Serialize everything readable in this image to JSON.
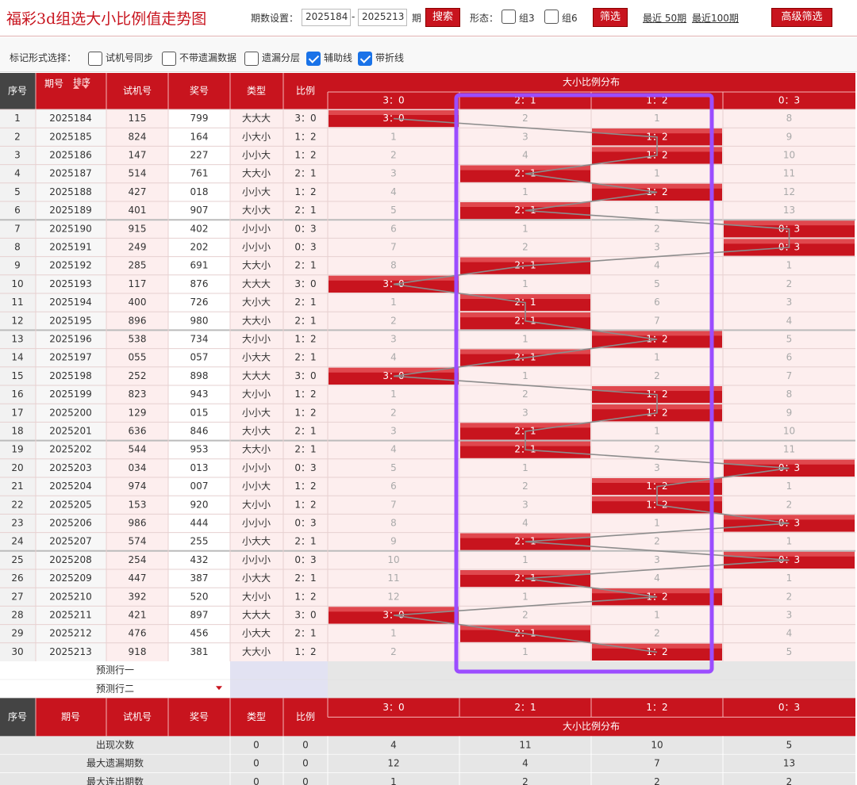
{
  "title": "福彩3d组选大小比例值走势图",
  "period_setting": {
    "label": "期数设置：",
    "from": "2025184",
    "dash": "-",
    "to": "2025213",
    "unit": "期",
    "search_button": "搜索"
  },
  "form": {
    "label": "形态：",
    "options": [
      {
        "label": "组3",
        "checked": false
      },
      {
        "label": "组6",
        "checked": false
      }
    ],
    "filter_button": "筛选"
  },
  "recent_links": [
    "最近 50期",
    "最近100期"
  ],
  "advanced_button": "高级筛选",
  "mark_options": {
    "label": "标记形式选择：",
    "items": [
      {
        "label": "试机号同步",
        "checked": false
      },
      {
        "label": "不带遗漏数据",
        "checked": false
      },
      {
        "label": "遗漏分层",
        "checked": false
      },
      {
        "label": "辅助线",
        "checked": true
      },
      {
        "label": "带折线",
        "checked": true
      }
    ]
  },
  "table": {
    "headers": {
      "seq": "序号",
      "period": "期号",
      "sort_label": "排序",
      "trial": "试机号",
      "prize": "奖号",
      "type": "类型",
      "ratio": "比例",
      "dist": "大小比例分布"
    },
    "dist_columns": [
      "3：0",
      "2：1",
      "1：2",
      "0：3"
    ],
    "rows": [
      {
        "seq": "1",
        "period": "2025184",
        "trial": "115",
        "prize": "799",
        "type": "大大大",
        "ratio": "3：0",
        "dist": [
          "3：0",
          "2",
          "1",
          "8"
        ],
        "hit": 0
      },
      {
        "seq": "2",
        "period": "2025185",
        "trial": "824",
        "prize": "164",
        "type": "小大小",
        "ratio": "1：2",
        "dist": [
          "1",
          "3",
          "1：2",
          "9"
        ],
        "hit": 2
      },
      {
        "seq": "3",
        "period": "2025186",
        "trial": "147",
        "prize": "227",
        "type": "小小大",
        "ratio": "1：2",
        "dist": [
          "2",
          "4",
          "1：2",
          "10"
        ],
        "hit": 2
      },
      {
        "seq": "4",
        "period": "2025187",
        "trial": "514",
        "prize": "761",
        "type": "大大小",
        "ratio": "2：1",
        "dist": [
          "3",
          "2：1",
          "1",
          "11"
        ],
        "hit": 1
      },
      {
        "seq": "5",
        "period": "2025188",
        "trial": "427",
        "prize": "018",
        "type": "小小大",
        "ratio": "1：2",
        "dist": [
          "4",
          "1",
          "1：2",
          "12"
        ],
        "hit": 2
      },
      {
        "seq": "6",
        "period": "2025189",
        "trial": "401",
        "prize": "907",
        "type": "大小大",
        "ratio": "2：1",
        "dist": [
          "5",
          "2：1",
          "1",
          "13"
        ],
        "hit": 1
      },
      {
        "seq": "7",
        "period": "2025190",
        "trial": "915",
        "prize": "402",
        "type": "小小小",
        "ratio": "0：3",
        "dist": [
          "6",
          "1",
          "2",
          "0：3"
        ],
        "hit": 3
      },
      {
        "seq": "8",
        "period": "2025191",
        "trial": "249",
        "prize": "202",
        "type": "小小小",
        "ratio": "0：3",
        "dist": [
          "7",
          "2",
          "3",
          "0：3"
        ],
        "hit": 3
      },
      {
        "seq": "9",
        "period": "2025192",
        "trial": "285",
        "prize": "691",
        "type": "大大小",
        "ratio": "2：1",
        "dist": [
          "8",
          "2：1",
          "4",
          "1"
        ],
        "hit": 1
      },
      {
        "seq": "10",
        "period": "2025193",
        "trial": "117",
        "prize": "876",
        "type": "大大大",
        "ratio": "3：0",
        "dist": [
          "3：0",
          "1",
          "5",
          "2"
        ],
        "hit": 0
      },
      {
        "seq": "11",
        "period": "2025194",
        "trial": "400",
        "prize": "726",
        "type": "大小大",
        "ratio": "2：1",
        "dist": [
          "1",
          "2：1",
          "6",
          "3"
        ],
        "hit": 1
      },
      {
        "seq": "12",
        "period": "2025195",
        "trial": "896",
        "prize": "980",
        "type": "大大小",
        "ratio": "2：1",
        "dist": [
          "2",
          "2：1",
          "7",
          "4"
        ],
        "hit": 1
      },
      {
        "seq": "13",
        "period": "2025196",
        "trial": "538",
        "prize": "734",
        "type": "大小小",
        "ratio": "1：2",
        "dist": [
          "3",
          "1",
          "1：2",
          "5"
        ],
        "hit": 2
      },
      {
        "seq": "14",
        "period": "2025197",
        "trial": "055",
        "prize": "057",
        "type": "小大大",
        "ratio": "2：1",
        "dist": [
          "4",
          "2：1",
          "1",
          "6"
        ],
        "hit": 1
      },
      {
        "seq": "15",
        "period": "2025198",
        "trial": "252",
        "prize": "898",
        "type": "大大大",
        "ratio": "3：0",
        "dist": [
          "3：0",
          "1",
          "2",
          "7"
        ],
        "hit": 0
      },
      {
        "seq": "16",
        "period": "2025199",
        "trial": "823",
        "prize": "943",
        "type": "大小小",
        "ratio": "1：2",
        "dist": [
          "1",
          "2",
          "1：2",
          "8"
        ],
        "hit": 2
      },
      {
        "seq": "17",
        "period": "2025200",
        "trial": "129",
        "prize": "015",
        "type": "小小大",
        "ratio": "1：2",
        "dist": [
          "2",
          "3",
          "1：2",
          "9"
        ],
        "hit": 2
      },
      {
        "seq": "18",
        "period": "2025201",
        "trial": "636",
        "prize": "846",
        "type": "大小大",
        "ratio": "2：1",
        "dist": [
          "3",
          "2：1",
          "1",
          "10"
        ],
        "hit": 1
      },
      {
        "seq": "19",
        "period": "2025202",
        "trial": "544",
        "prize": "953",
        "type": "大大小",
        "ratio": "2：1",
        "dist": [
          "4",
          "2：1",
          "2",
          "11"
        ],
        "hit": 1
      },
      {
        "seq": "20",
        "period": "2025203",
        "trial": "034",
        "prize": "013",
        "type": "小小小",
        "ratio": "0：3",
        "dist": [
          "5",
          "1",
          "3",
          "0：3"
        ],
        "hit": 3
      },
      {
        "seq": "21",
        "period": "2025204",
        "trial": "974",
        "prize": "007",
        "type": "小小大",
        "ratio": "1：2",
        "dist": [
          "6",
          "2",
          "1：2",
          "1"
        ],
        "hit": 2
      },
      {
        "seq": "22",
        "period": "2025205",
        "trial": "153",
        "prize": "920",
        "type": "大小小",
        "ratio": "1：2",
        "dist": [
          "7",
          "3",
          "1：2",
          "2"
        ],
        "hit": 2
      },
      {
        "seq": "23",
        "period": "2025206",
        "trial": "986",
        "prize": "444",
        "type": "小小小",
        "ratio": "0：3",
        "dist": [
          "8",
          "4",
          "1",
          "0：3"
        ],
        "hit": 3
      },
      {
        "seq": "24",
        "period": "2025207",
        "trial": "574",
        "prize": "255",
        "type": "小大大",
        "ratio": "2：1",
        "dist": [
          "9",
          "2：1",
          "2",
          "1"
        ],
        "hit": 1
      },
      {
        "seq": "25",
        "period": "2025208",
        "trial": "254",
        "prize": "432",
        "type": "小小小",
        "ratio": "0：3",
        "dist": [
          "10",
          "1",
          "3",
          "0：3"
        ],
        "hit": 3
      },
      {
        "seq": "26",
        "period": "2025209",
        "trial": "447",
        "prize": "387",
        "type": "小大大",
        "ratio": "2：1",
        "dist": [
          "11",
          "2：1",
          "4",
          "1"
        ],
        "hit": 1
      },
      {
        "seq": "27",
        "period": "2025210",
        "trial": "392",
        "prize": "520",
        "type": "大小小",
        "ratio": "1：2",
        "dist": [
          "12",
          "1",
          "1：2",
          "2"
        ],
        "hit": 2
      },
      {
        "seq": "28",
        "period": "2025211",
        "trial": "421",
        "prize": "897",
        "type": "大大大",
        "ratio": "3：0",
        "dist": [
          "3：0",
          "2",
          "1",
          "3"
        ],
        "hit": 0
      },
      {
        "seq": "29",
        "period": "2025212",
        "trial": "476",
        "prize": "456",
        "type": "小大大",
        "ratio": "2：1",
        "dist": [
          "1",
          "2：1",
          "2",
          "4"
        ],
        "hit": 1
      },
      {
        "seq": "30",
        "period": "2025213",
        "trial": "918",
        "prize": "381",
        "type": "大大小",
        "ratio": "1：2",
        "dist": [
          "2",
          "1",
          "1：2",
          "5"
        ],
        "hit": 2
      }
    ],
    "predict_rows": [
      "预测行一",
      "预测行二"
    ],
    "stats": [
      {
        "label": "出现次数",
        "type": "0",
        "ratio": "0",
        "dist": [
          "4",
          "11",
          "10",
          "5"
        ]
      },
      {
        "label": "最大遗漏期数",
        "type": "0",
        "ratio": "0",
        "dist": [
          "12",
          "4",
          "7",
          "13"
        ]
      },
      {
        "label": "最大连出期数",
        "type": "0",
        "ratio": "0",
        "dist": [
          "1",
          "2",
          "2",
          "2"
        ]
      }
    ]
  },
  "colors": {
    "brand_red": "#c8141e",
    "header_red": "#c8141e",
    "cell_pink": "#fdeeee",
    "miss_text": "#aaaaaa",
    "line": "#8c8c8c",
    "highlight_box": "#9b4dff",
    "checkbox_blue": "#1a73e8"
  }
}
